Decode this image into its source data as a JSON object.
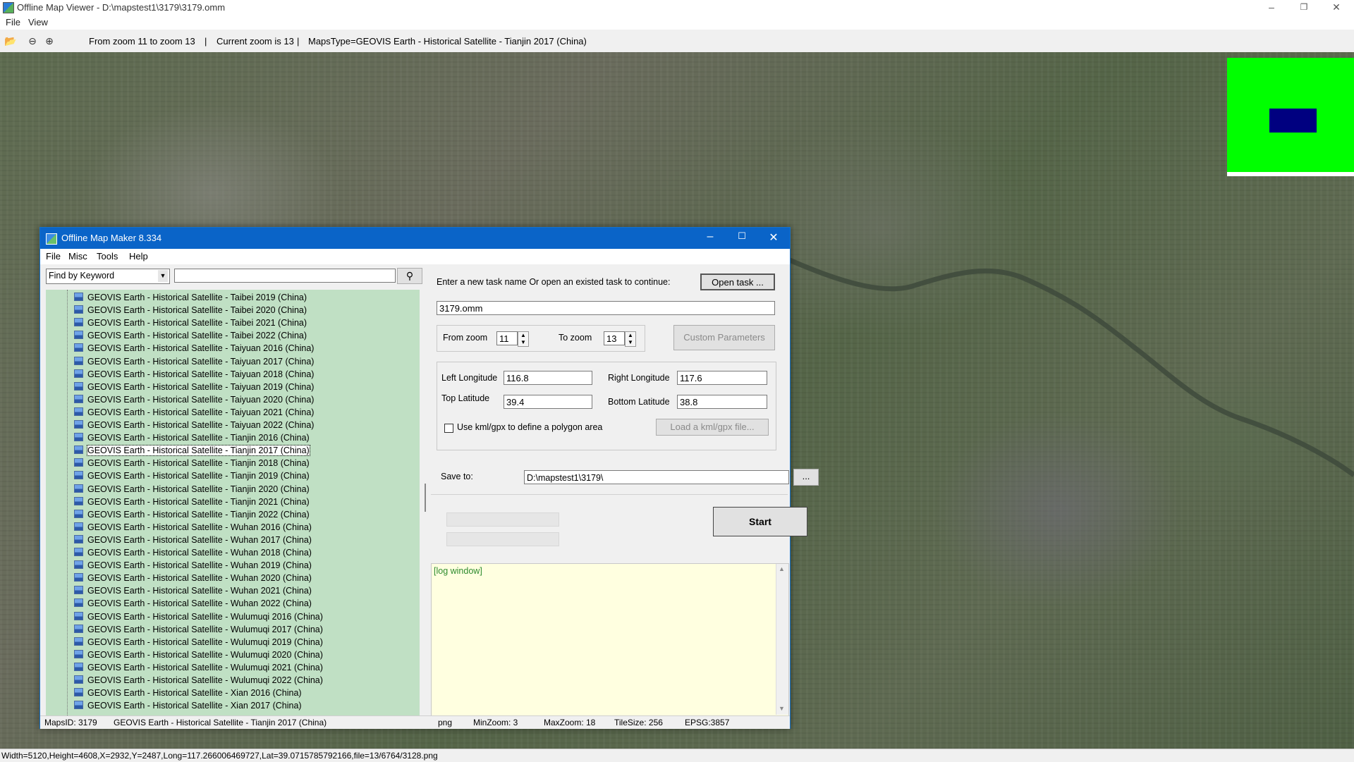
{
  "window": {
    "title": "Offline Map Viewer - D:\\mapstest1\\3179\\3179.omm"
  },
  "menu": [
    "File",
    "View"
  ],
  "toolbar": {
    "zoom_range": "From zoom 11 to zoom 13",
    "current_zoom": "Current zoom is 13",
    "maps_type": "MapsType=GEOVIS Earth - Historical Satellite - Tianjin 2017 (China)",
    "sep": "|"
  },
  "status": {
    "text": "Width=5120,Height=4608,X=2932,Y=2487,Long=117.266006469727,Lat=39.0715785792166,file=13/6764/3128.png"
  },
  "colors": {
    "minimap_bg": "#00ff00",
    "minimap_viewport": "#000080",
    "dialog_title": "#0a64c8",
    "list_bg": "#c0e0c4",
    "log_bg": "#ffffe0"
  },
  "dialog": {
    "title": "Offline Map Maker 8.334",
    "menu": [
      "File",
      "Misc",
      "Tools",
      "Help"
    ],
    "search": {
      "mode": "Find by Keyword",
      "value": ""
    },
    "task_prompt": "Enter a new task name Or open an existed task to continue:",
    "open_task": "Open task ...",
    "task_name": "3179.omm",
    "from_zoom_label": "From zoom",
    "from_zoom": "11",
    "to_zoom_label": "To zoom",
    "to_zoom": "13",
    "custom_params": "Custom Parameters",
    "left_lon_label": "Left Longitude",
    "left_lon": "116.8",
    "right_lon_label": "Right Longitude",
    "right_lon": "117.6",
    "top_lat_label": "Top Latitude",
    "top_lat": "39.4",
    "bottom_lat_label": "Bottom Latitude",
    "bottom_lat": "38.8",
    "kml_label": "Use kml/gpx to define a polygon area",
    "kml_button": "Load a kml/gpx file...",
    "save_label": "Save to:",
    "save_path": "D:\\mapstest1\\3179\\",
    "browse": "...",
    "start": "Start",
    "log": "[log window]",
    "list_items": [
      "GEOVIS Earth - Historical Satellite - Taibei 2019 (China)",
      "GEOVIS Earth - Historical Satellite - Taibei 2020 (China)",
      "GEOVIS Earth - Historical Satellite - Taibei 2021 (China)",
      "GEOVIS Earth - Historical Satellite - Taibei 2022 (China)",
      "GEOVIS Earth - Historical Satellite - Taiyuan 2016 (China)",
      "GEOVIS Earth - Historical Satellite - Taiyuan 2017 (China)",
      "GEOVIS Earth - Historical Satellite - Taiyuan 2018 (China)",
      "GEOVIS Earth - Historical Satellite - Taiyuan 2019 (China)",
      "GEOVIS Earth - Historical Satellite - Taiyuan 2020 (China)",
      "GEOVIS Earth - Historical Satellite - Taiyuan 2021 (China)",
      "GEOVIS Earth - Historical Satellite - Taiyuan 2022 (China)",
      "GEOVIS Earth - Historical Satellite - Tianjin 2016 (China)",
      "GEOVIS Earth - Historical Satellite - Tianjin 2017 (China)",
      "GEOVIS Earth - Historical Satellite - Tianjin 2018 (China)",
      "GEOVIS Earth - Historical Satellite - Tianjin 2019 (China)",
      "GEOVIS Earth - Historical Satellite - Tianjin 2020 (China)",
      "GEOVIS Earth - Historical Satellite - Tianjin 2021 (China)",
      "GEOVIS Earth - Historical Satellite - Tianjin 2022 (China)",
      "GEOVIS Earth - Historical Satellite - Wuhan 2016 (China)",
      "GEOVIS Earth - Historical Satellite - Wuhan 2017 (China)",
      "GEOVIS Earth - Historical Satellite - Wuhan 2018 (China)",
      "GEOVIS Earth - Historical Satellite - Wuhan 2019 (China)",
      "GEOVIS Earth - Historical Satellite - Wuhan 2020 (China)",
      "GEOVIS Earth - Historical Satellite - Wuhan 2021 (China)",
      "GEOVIS Earth - Historical Satellite - Wuhan 2022 (China)",
      "GEOVIS Earth - Historical Satellite - Wulumuqi 2016 (China)",
      "GEOVIS Earth - Historical Satellite - Wulumuqi 2017 (China)",
      "GEOVIS Earth - Historical Satellite - Wulumuqi 2019 (China)",
      "GEOVIS Earth - Historical Satellite - Wulumuqi 2020 (China)",
      "GEOVIS Earth - Historical Satellite - Wulumuqi 2021 (China)",
      "GEOVIS Earth - Historical Satellite - Wulumuqi 2022 (China)",
      "GEOVIS Earth - Historical Satellite - Xian 2016 (China)",
      "GEOVIS Earth - Historical Satellite - Xian 2017 (China)"
    ],
    "selected_item": "GEOVIS Earth - Historical Satellite - Tianjin 2017 (China)",
    "status": {
      "maps_id": "MapsID: 3179",
      "maps_name": "GEOVIS Earth - Historical Satellite - Tianjin 2017 (China)",
      "format": "png",
      "min_zoom": "MinZoom: 3",
      "max_zoom": "MaxZoom: 18",
      "tile_size": "TileSize: 256",
      "epsg": "EPSG:3857"
    }
  }
}
